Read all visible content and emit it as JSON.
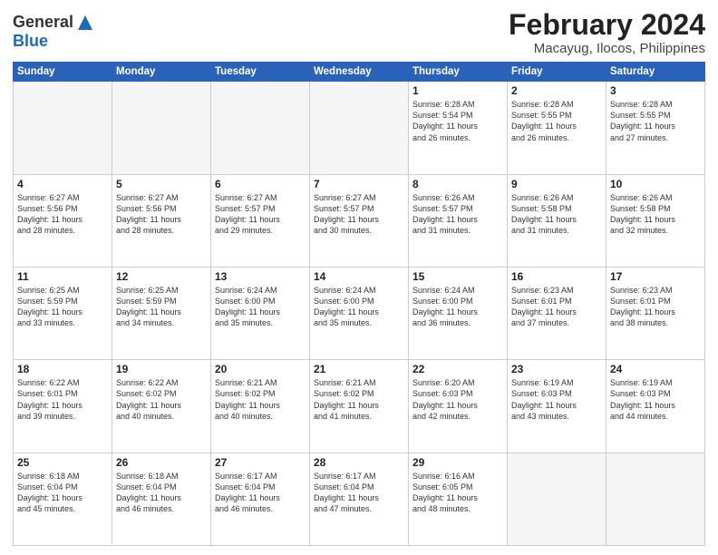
{
  "header": {
    "logo_line1": "General",
    "logo_line2": "Blue",
    "month_title": "February 2024",
    "location": "Macayug, Ilocos, Philippines"
  },
  "weekdays": [
    "Sunday",
    "Monday",
    "Tuesday",
    "Wednesday",
    "Thursday",
    "Friday",
    "Saturday"
  ],
  "weeks": [
    [
      {
        "day": "",
        "info": ""
      },
      {
        "day": "",
        "info": ""
      },
      {
        "day": "",
        "info": ""
      },
      {
        "day": "",
        "info": ""
      },
      {
        "day": "1",
        "info": "Sunrise: 6:28 AM\nSunset: 5:54 PM\nDaylight: 11 hours\nand 26 minutes."
      },
      {
        "day": "2",
        "info": "Sunrise: 6:28 AM\nSunset: 5:55 PM\nDaylight: 11 hours\nand 26 minutes."
      },
      {
        "day": "3",
        "info": "Sunrise: 6:28 AM\nSunset: 5:55 PM\nDaylight: 11 hours\nand 27 minutes."
      }
    ],
    [
      {
        "day": "4",
        "info": "Sunrise: 6:27 AM\nSunset: 5:56 PM\nDaylight: 11 hours\nand 28 minutes."
      },
      {
        "day": "5",
        "info": "Sunrise: 6:27 AM\nSunset: 5:56 PM\nDaylight: 11 hours\nand 28 minutes."
      },
      {
        "day": "6",
        "info": "Sunrise: 6:27 AM\nSunset: 5:57 PM\nDaylight: 11 hours\nand 29 minutes."
      },
      {
        "day": "7",
        "info": "Sunrise: 6:27 AM\nSunset: 5:57 PM\nDaylight: 11 hours\nand 30 minutes."
      },
      {
        "day": "8",
        "info": "Sunrise: 6:26 AM\nSunset: 5:57 PM\nDaylight: 11 hours\nand 31 minutes."
      },
      {
        "day": "9",
        "info": "Sunrise: 6:26 AM\nSunset: 5:58 PM\nDaylight: 11 hours\nand 31 minutes."
      },
      {
        "day": "10",
        "info": "Sunrise: 6:26 AM\nSunset: 5:58 PM\nDaylight: 11 hours\nand 32 minutes."
      }
    ],
    [
      {
        "day": "11",
        "info": "Sunrise: 6:25 AM\nSunset: 5:59 PM\nDaylight: 11 hours\nand 33 minutes."
      },
      {
        "day": "12",
        "info": "Sunrise: 6:25 AM\nSunset: 5:59 PM\nDaylight: 11 hours\nand 34 minutes."
      },
      {
        "day": "13",
        "info": "Sunrise: 6:24 AM\nSunset: 6:00 PM\nDaylight: 11 hours\nand 35 minutes."
      },
      {
        "day": "14",
        "info": "Sunrise: 6:24 AM\nSunset: 6:00 PM\nDaylight: 11 hours\nand 35 minutes."
      },
      {
        "day": "15",
        "info": "Sunrise: 6:24 AM\nSunset: 6:00 PM\nDaylight: 11 hours\nand 36 minutes."
      },
      {
        "day": "16",
        "info": "Sunrise: 6:23 AM\nSunset: 6:01 PM\nDaylight: 11 hours\nand 37 minutes."
      },
      {
        "day": "17",
        "info": "Sunrise: 6:23 AM\nSunset: 6:01 PM\nDaylight: 11 hours\nand 38 minutes."
      }
    ],
    [
      {
        "day": "18",
        "info": "Sunrise: 6:22 AM\nSunset: 6:01 PM\nDaylight: 11 hours\nand 39 minutes."
      },
      {
        "day": "19",
        "info": "Sunrise: 6:22 AM\nSunset: 6:02 PM\nDaylight: 11 hours\nand 40 minutes."
      },
      {
        "day": "20",
        "info": "Sunrise: 6:21 AM\nSunset: 6:02 PM\nDaylight: 11 hours\nand 40 minutes."
      },
      {
        "day": "21",
        "info": "Sunrise: 6:21 AM\nSunset: 6:02 PM\nDaylight: 11 hours\nand 41 minutes."
      },
      {
        "day": "22",
        "info": "Sunrise: 6:20 AM\nSunset: 6:03 PM\nDaylight: 11 hours\nand 42 minutes."
      },
      {
        "day": "23",
        "info": "Sunrise: 6:19 AM\nSunset: 6:03 PM\nDaylight: 11 hours\nand 43 minutes."
      },
      {
        "day": "24",
        "info": "Sunrise: 6:19 AM\nSunset: 6:03 PM\nDaylight: 11 hours\nand 44 minutes."
      }
    ],
    [
      {
        "day": "25",
        "info": "Sunrise: 6:18 AM\nSunset: 6:04 PM\nDaylight: 11 hours\nand 45 minutes."
      },
      {
        "day": "26",
        "info": "Sunrise: 6:18 AM\nSunset: 6:04 PM\nDaylight: 11 hours\nand 46 minutes."
      },
      {
        "day": "27",
        "info": "Sunrise: 6:17 AM\nSunset: 6:04 PM\nDaylight: 11 hours\nand 46 minutes."
      },
      {
        "day": "28",
        "info": "Sunrise: 6:17 AM\nSunset: 6:04 PM\nDaylight: 11 hours\nand 47 minutes."
      },
      {
        "day": "29",
        "info": "Sunrise: 6:16 AM\nSunset: 6:05 PM\nDaylight: 11 hours\nand 48 minutes."
      },
      {
        "day": "",
        "info": ""
      },
      {
        "day": "",
        "info": ""
      }
    ]
  ]
}
